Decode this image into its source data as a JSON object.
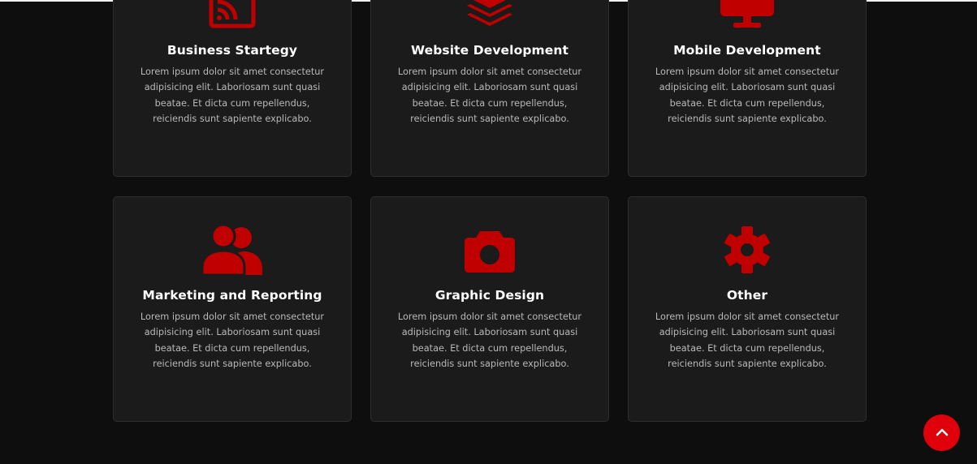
{
  "services": [
    {
      "icon": "rss-feed-icon",
      "title": "Business Startegy",
      "description": "Lorem ipsum dolor sit amet consectetur adipisicing elit. Laboriosam sunt quasi beatae. Et dicta cum repellendus, reiciendis sunt sapiente explicabo."
    },
    {
      "icon": "layers-icon",
      "title": "Website Development",
      "description": "Lorem ipsum dolor sit amet consectetur adipisicing elit. Laboriosam sunt quasi beatae. Et dicta cum repellendus, reiciendis sunt sapiente explicabo."
    },
    {
      "icon": "monitor-icon",
      "title": "Mobile Development",
      "description": "Lorem ipsum dolor sit amet consectetur adipisicing elit. Laboriosam sunt quasi beatae. Et dicta cum repellendus, reiciendis sunt sapiente explicabo."
    },
    {
      "icon": "users-icon",
      "title": "Marketing and Reporting",
      "description": "Lorem ipsum dolor sit amet consectetur adipisicing elit. Laboriosam sunt quasi beatae. Et dicta cum repellendus, reiciendis sunt sapiente explicabo."
    },
    {
      "icon": "camera-icon",
      "title": "Graphic Design",
      "description": "Lorem ipsum dolor sit amet consectetur adipisicing elit. Laboriosam sunt quasi beatae. Et dicta cum repellendus, reiciendis sunt sapiente explicabo."
    },
    {
      "icon": "gear-icon",
      "title": "Other",
      "description": "Lorem ipsum dolor sit amet consectetur adipisicing elit. Laboriosam sunt quasi beatae. Et dicta cum repellendus, reiciendis sunt sapiente explicabo."
    }
  ],
  "scroll_top_icon": "chevron-up-icon",
  "colors": {
    "accent": "#c00000",
    "button": "#e0000b",
    "card_bg": "#1b1b1b",
    "page_bg": "#0e0e0e"
  }
}
